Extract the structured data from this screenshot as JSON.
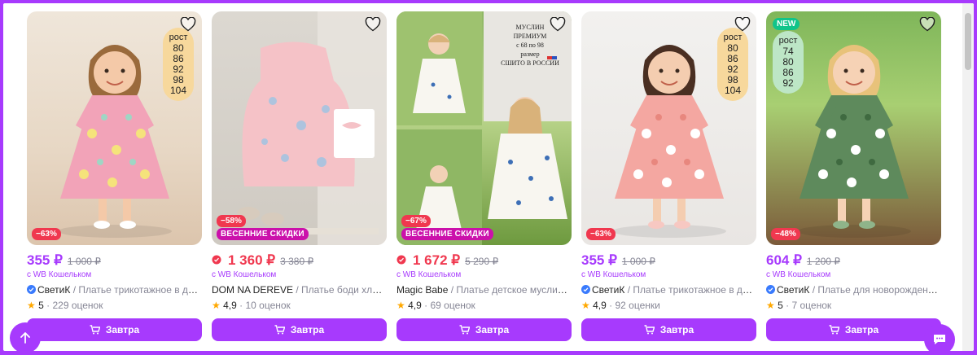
{
  "colors": {
    "accent": "#a73afd",
    "discount": "#f0384f",
    "promo": "#cb11ab",
    "star": "#ffa800",
    "new": "#10c48a"
  },
  "cards": [
    {
      "price": "355 ₽",
      "old_price": "1 000 ₽",
      "wallet": "с WB Кошельком",
      "brand": "СветиК",
      "name": "/ Платье трикотажное в детск...",
      "rating": "5",
      "reviews": "· 229 оценок",
      "discount": "−63%",
      "size_label": "рост",
      "sizes": [
        "80",
        "86",
        "92",
        "98",
        "104"
      ],
      "button": "Завтра",
      "verified": true
    },
    {
      "price": "1 360 ₽",
      "old_price": "3 380 ₽",
      "wallet": "с WB Кошельком",
      "brand": "DOM NA DEREVE",
      "name": "/ Платье боди хлопков...",
      "rating": "4,9",
      "reviews": "· 10 оценок",
      "discount": "−58%",
      "promo": "ВЕСЕННИЕ СКИДКИ",
      "button": "Завтра",
      "verified": false
    },
    {
      "price": "1 672 ₽",
      "old_price": "5 290 ₽",
      "wallet": "с WB Кошельком",
      "brand": "Magic Babe",
      "name": "/ Платье детское муслин на...",
      "rating": "4,9",
      "reviews": "· 69 оценок",
      "discount": "−67%",
      "promo": "ВЕСЕННИЕ СКИДКИ",
      "overlay": [
        "МУСЛИН",
        "ПРЕМИУМ",
        "с 68 по 98",
        "размер",
        "СШИТО В РОССИИ"
      ],
      "button": "Завтра",
      "verified": false
    },
    {
      "price": "355 ₽",
      "old_price": "1 000 ₽",
      "wallet": "с WB Кошельком",
      "brand": "СветиК",
      "name": "/ Платье трикотажное в детск...",
      "rating": "4,9",
      "reviews": "· 92 оценки",
      "discount": "−63%",
      "size_label": "рост",
      "sizes": [
        "80",
        "86",
        "92",
        "98",
        "104"
      ],
      "button": "Завтра",
      "verified": true
    },
    {
      "price": "604 ₽",
      "old_price": "1 200 ₽",
      "wallet": "с WB Кошельком",
      "brand": "СветиК",
      "name": "/ Платье для новорожденных",
      "rating": "5",
      "reviews": "· 7 оценок",
      "discount": "−48%",
      "new": "NEW",
      "size_label": "рост",
      "sizes": [
        "74",
        "80",
        "86",
        "92"
      ],
      "button": "Завтра",
      "verified": true
    }
  ]
}
